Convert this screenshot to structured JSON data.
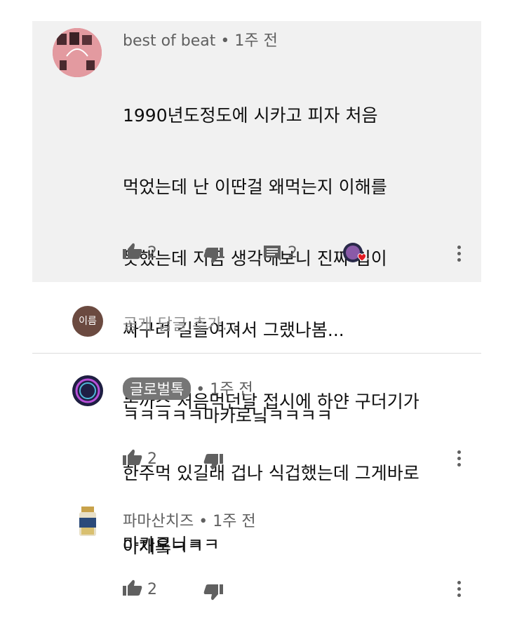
{
  "comments": [
    {
      "author": "best of beat",
      "time": "1주 전",
      "lines": [
        "1990년도정도에 시카고 피자 처음",
        "먹었는데 난 이딴걸 왜먹는지 이해를",
        "못했는데 지금 생각해보니 진짜 입이",
        "싸구려 길들여져서 그랬나봄...",
        "돈까스 처음먹던날 접시에 하얀 구더기가",
        "한주먹 있길래 겁나 식겁했는데 그게바로",
        "마카로니ㅋㅋ"
      ],
      "likes": "2",
      "replies": "2"
    }
  ],
  "reply_box": {
    "avatar_text": "이름",
    "placeholder": "공개 답글 추가..."
  },
  "replies": [
    {
      "author": "글로벌톡",
      "time": "1주 전",
      "text": "ㅋㅋㅋㅋㅋ마카로닠ㅋㅋㅋㅋ",
      "likes": "2"
    },
    {
      "author": "파마산치즈",
      "time": "1주 전",
      "text": "아재욬ㅋㅋ",
      "likes": "2"
    }
  ],
  "colors": {
    "panel_bg": "#f1f1f1",
    "text": "#0f0f0f",
    "muted": "#606060",
    "heart": "#e31b23"
  }
}
